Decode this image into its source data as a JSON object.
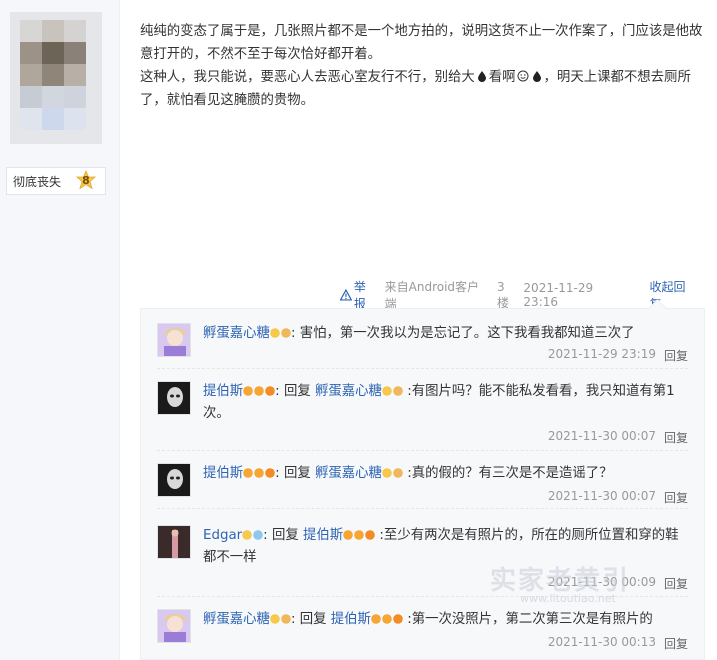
{
  "author": {
    "name": "彻底丧失",
    "level": "8"
  },
  "post": {
    "line1": "纯纯的变态了属于是，几张照片都不是一个地方拍的，说明这货不止一次作案了，门应该是他故意打开的，不然不至于每次恰好都开着。",
    "line2a": "这种人，我只能说，要恶心人去恶心室友行不行，别给大",
    "line2b": "看啊",
    "line2c": "，明天上课都不想去厕所了，就怕看见这腌臜的贵物。",
    "report": "举报",
    "source": "来自Android客户端",
    "floor": "3楼",
    "time": "2021-11-29 23:16",
    "collapse": "收起回复"
  },
  "replies": [
    {
      "user": "孵蛋嘉心糖",
      "reply_prefix": "",
      "reply_to": "",
      "text": ": 害怕，第一次我以为是忘记了。这下我看我都知道三次了",
      "time": "2021-11-29 23:19",
      "action": "回复"
    },
    {
      "user": "提伯斯",
      "reply_prefix": ": 回复 ",
      "reply_to": "孵蛋嘉心糖",
      "text": " :有图片吗？能不能私发看看，我只知道有第1次。",
      "time": "2021-11-30 00:07",
      "action": "回复"
    },
    {
      "user": "提伯斯",
      "reply_prefix": ": 回复 ",
      "reply_to": "孵蛋嘉心糖",
      "text": " :真的假的？有三次是不是造谣了？",
      "time": "2021-11-30 00:07",
      "action": "回复"
    },
    {
      "user": "Edgar",
      "reply_prefix": ": 回复 ",
      "reply_to": "提伯斯",
      "text": " :至少有两次是有照片的，所在的厕所位置和穿的鞋都不一样",
      "time": "2021-11-30 00:09",
      "action": "回复"
    },
    {
      "user": "孵蛋嘉心糖",
      "reply_prefix": ": 回复 ",
      "reply_to": "提伯斯",
      "text": " :第一次没照片，第二次第三次是有照片的",
      "time": "2021-11-30 00:13",
      "action": "回复"
    }
  ],
  "watermark": {
    "text": "实家老黄引",
    "url": "www.lltoutiao.net"
  },
  "colors": {
    "link": "#2d64b3",
    "meta": "#999999",
    "reply_bg": "#f7f8fa"
  }
}
